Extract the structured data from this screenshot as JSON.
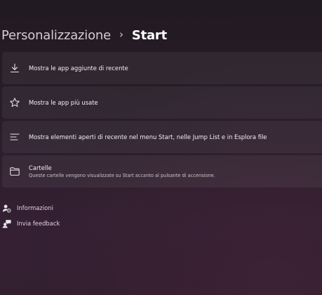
{
  "breadcrumb": {
    "parent": "Personalizzazione",
    "separator": "›",
    "current": "Start"
  },
  "settings": [
    {
      "icon": "download-icon",
      "title": "Mostra le app aggiunte di recente"
    },
    {
      "icon": "star-icon",
      "title": "Mostra le app più usate"
    },
    {
      "icon": "list-icon",
      "title": "Mostra elementi aperti di recente nel menu Start, nelle Jump List e in Esplora file"
    },
    {
      "icon": "folder-icon",
      "title": "Cartelle",
      "subtitle": "Queste cartelle vengono visualizzate su Start accanto al pulsante di accensione."
    }
  ],
  "links": [
    {
      "icon": "help-person-icon",
      "label": "Informazioni"
    },
    {
      "icon": "feedback-icon",
      "label": "Invia feedback"
    }
  ],
  "colors": {
    "link_text": "#e6c8e6",
    "card_background": "#2f2630",
    "page_background": "#241b25"
  }
}
